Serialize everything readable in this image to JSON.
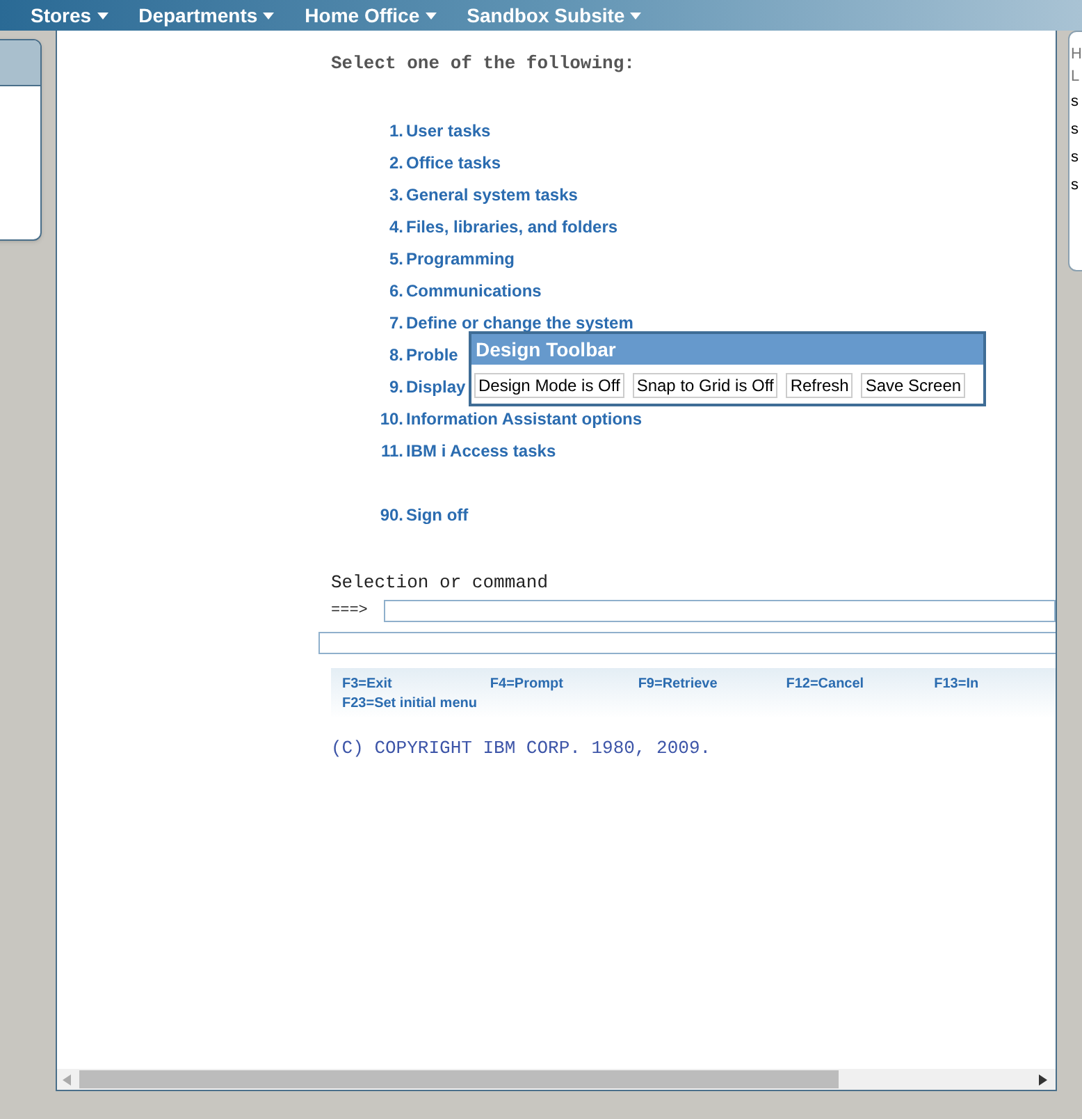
{
  "nav": [
    {
      "label": "Stores"
    },
    {
      "label": "Departments"
    },
    {
      "label": "Home Office"
    },
    {
      "label": "Sandbox Subsite"
    }
  ],
  "right_card": {
    "lines": [
      "H",
      "L",
      "s",
      "s",
      "s",
      "s"
    ]
  },
  "screen": {
    "prompt": "Select one of the following:",
    "menu": [
      {
        "number": "1.",
        "label": "User tasks"
      },
      {
        "number": "2.",
        "label": "Office tasks"
      },
      {
        "number": "3.",
        "label": "General system tasks"
      },
      {
        "number": "4.",
        "label": "Files, libraries, and folders"
      },
      {
        "number": "5.",
        "label": "Programming"
      },
      {
        "number": "6.",
        "label": "Communications"
      },
      {
        "number": "7.",
        "label": "Define or change the system"
      },
      {
        "number": "8.",
        "label": "Proble"
      },
      {
        "number": "9.",
        "label": "Display"
      },
      {
        "number": "10.",
        "label": "Information Assistant options"
      },
      {
        "number": "11.",
        "label": "IBM i Access tasks"
      },
      {
        "number": "90.",
        "label": "Sign off",
        "gap_before": true
      }
    ],
    "command_label": "Selection or command",
    "command_arrow": "===>",
    "function_keys": [
      [
        "F3=Exit",
        "F4=Prompt",
        "F9=Retrieve",
        "F12=Cancel",
        "F13=In"
      ],
      [
        "F23=Set initial menu"
      ]
    ],
    "copyright": "(C) COPYRIGHT IBM CORP. 1980, 2009."
  },
  "design_toolbar": {
    "title": "Design Toolbar",
    "buttons": [
      "Design Mode is Off",
      "Snap to Grid is Off",
      "Refresh",
      "Save Screen"
    ]
  }
}
